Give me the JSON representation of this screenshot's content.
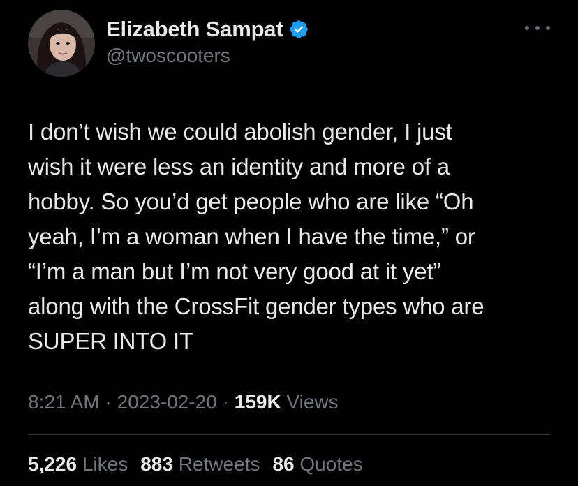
{
  "colors": {
    "background": "#000000",
    "primary_text": "#e7e9ea",
    "secondary_text": "#71767b",
    "verified": "#1d9bf0",
    "divider": "#2f3336"
  },
  "author": {
    "display_name": "Elizabeth Sampat",
    "handle": "@twoscooters",
    "verified_icon": "verified-badge-icon",
    "avatar_icon": "avatar-photo"
  },
  "tweet": {
    "lines": [
      "I don’t wish we could abolish gender, I just",
      "wish it were less an identity and more of a",
      "hobby. So you’d get people who are like “Oh",
      "yeah, I’m a woman when I have the time,” or",
      "“I’m a man but I’m not very good at it yet”",
      "along with the CrossFit gender types who are",
      "SUPER INTO IT"
    ]
  },
  "meta": {
    "time": "8:21 AM",
    "separator": "·",
    "date": "2023-02-20",
    "views_count": "159K",
    "views_label": "Views"
  },
  "stats": {
    "likes_count": "5,226",
    "likes_label": "Likes",
    "retweets_count": "883",
    "retweets_label": "Retweets",
    "quotes_count": "86",
    "quotes_label": "Quotes"
  },
  "more_menu_icon": "more-horizontal-icon"
}
